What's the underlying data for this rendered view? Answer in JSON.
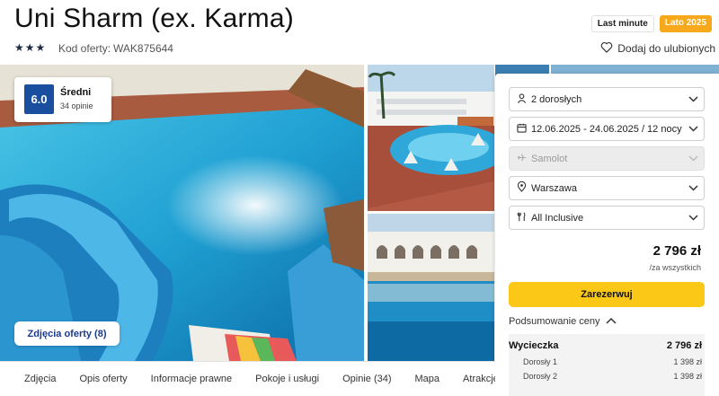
{
  "header": {
    "title": "Uni Sharm (ex. Karma)",
    "stars_display": "★★★",
    "offer_code_label": "Kod oferty:",
    "offer_code": "WAK875644",
    "badges": [
      "Last minute",
      "Lato 2025"
    ],
    "favorite_label": "Dodaj do ulubionych"
  },
  "rating": {
    "score": "6.0",
    "label": "Średni",
    "count": "34 opinie"
  },
  "gallery": {
    "photos_button": "Zdjęcia oferty (8)"
  },
  "booking": {
    "travelers": "2 dorosłych",
    "dates": "12.06.2025 - 24.06.2025 / 12 nocy",
    "transport": "Samolot",
    "departure": "Warszawa",
    "board": "All Inclusive",
    "price": "2 796 zł",
    "price_note": "/za wszystkich",
    "reserve_button": "Zarezerwuj",
    "summary_toggle": "Podsumowanie ceny",
    "summary": {
      "trip_label": "Wycieczka",
      "trip_price": "2 796 zł",
      "items": [
        {
          "label": "Dorosły 1",
          "price": "1 398 zł"
        },
        {
          "label": "Dorosły 2",
          "price": "1 398 zł"
        }
      ]
    }
  },
  "tabs": [
    "Zdjęcia",
    "Opis oferty",
    "Informacje prawne",
    "Pokoje i usługi",
    "Opinie (34)",
    "Mapa",
    "Atrakcje"
  ],
  "colors": {
    "accent_yellow": "#fcc817",
    "rating_blue": "#1a4fa0",
    "summer_badge": "#f7a81b",
    "link_blue": "#1a3a8a"
  }
}
